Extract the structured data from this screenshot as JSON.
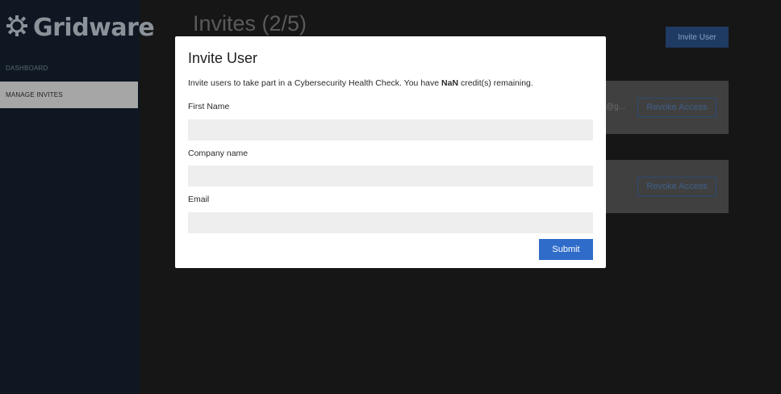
{
  "sidebar": {
    "logo_text": "Gridware",
    "items": [
      {
        "label": "DASHBOARD"
      },
      {
        "label": "MANAGE INVITES"
      }
    ]
  },
  "main": {
    "title": "Invites (2/5)",
    "invite_button": "Invite User",
    "cards": [
      {
        "email": "@g...",
        "action": "Revoke Access"
      },
      {
        "email": "",
        "action": "Revoke Access"
      }
    ]
  },
  "modal": {
    "title": "Invite User",
    "description_prefix": "Invite users to take part in a Cybersecurity Health Check. You have ",
    "credits": "NaN",
    "description_suffix": " credit(s) remaining.",
    "fields": [
      {
        "label": "First Name",
        "value": "",
        "placeholder": ""
      },
      {
        "label": "Company name",
        "value": "",
        "placeholder": ""
      },
      {
        "label": "Email",
        "value": "",
        "placeholder": ""
      }
    ],
    "submit_label": "Submit"
  },
  "colors": {
    "accent": "#2f6cc9",
    "sidebar_bg": "#0e1722",
    "overlay_bg": "#161616"
  }
}
